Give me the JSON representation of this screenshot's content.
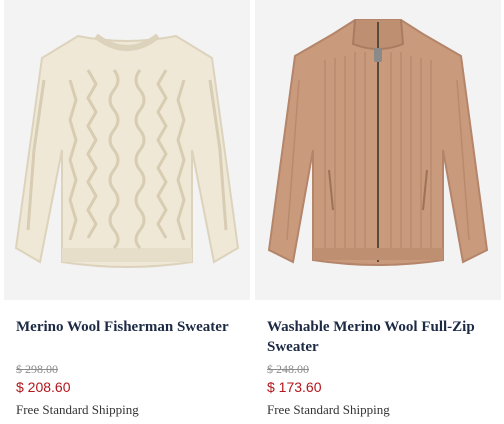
{
  "products": [
    {
      "title": "Merino Wool Fisherman Sweater",
      "original_price": "$ 298.00",
      "sale_price": "$ 208.60",
      "shipping": "Free Standard Shipping",
      "image_description": "cream cable-knit crewneck sweater",
      "colors": {
        "garment": "#efe8d6",
        "shade": "#ddd3bd"
      }
    },
    {
      "title": "Washable Merino Wool Full-Zip Sweater",
      "original_price": "$ 248.00",
      "sale_price": "$ 173.60",
      "shipping": "Free Standard Shipping",
      "image_description": "camel ribbed full-zip sweater",
      "colors": {
        "garment": "#c99a7c",
        "shade": "#b4856a"
      }
    }
  ],
  "colors": {
    "title": "#1c2a44",
    "sale_price": "#b3161b",
    "original_price": "#8c8c8c",
    "image_background": "#f2f2f2"
  }
}
